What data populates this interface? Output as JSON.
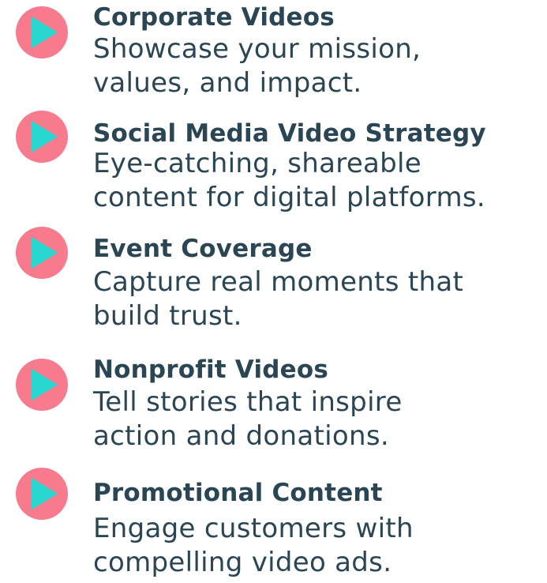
{
  "colors": {
    "circle": "#f77b8d",
    "play": "#28d8d0",
    "text": "#2a4553"
  },
  "services": [
    {
      "icon": "play-icon",
      "title": "Corporate Videos",
      "desc_lines": [
        "Showcase your mission,",
        "values, and impact."
      ]
    },
    {
      "icon": "play-icon",
      "title": "Social Media Video Strategy",
      "desc_lines": [
        "Eye-catching, shareable",
        "content for digital platforms."
      ]
    },
    {
      "icon": "play-icon",
      "title": "Event Coverage",
      "desc_lines": [
        "Capture real moments that",
        "build trust."
      ]
    },
    {
      "icon": "play-icon",
      "title": "Nonprofit Videos",
      "desc_lines": [
        "Tell stories that inspire",
        "action and donations."
      ]
    },
    {
      "icon": "play-icon",
      "title": "Promotional Content",
      "desc_lines": [
        "Engage customers with",
        "compelling video ads."
      ]
    }
  ]
}
